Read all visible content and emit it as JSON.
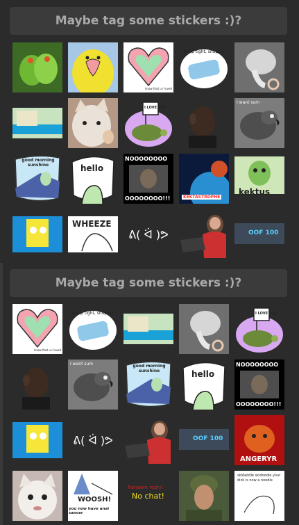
{
  "panels": [
    {
      "header": "Maybe tag some stickers :)?"
    },
    {
      "header": "Maybe tag some stickers :)?"
    }
  ],
  "stickers": {
    "sleep": "sleep tight, snupper",
    "know": "know that u r loved",
    "iloveyou": "I LOVE YOU",
    "iwantsum": "I want sum",
    "goodmorning": "good morning sunshine",
    "hello": "hello",
    "noooo_top": "NOOOOOOOO",
    "noooo_bot": "OOOOOOOO!!!",
    "kektastrophe": "KEKTASTROPHE",
    "kektus": "kektus",
    "wheeze": "WHEEZE",
    "shrug": "ᕕ( ᐛ )ᕗ",
    "oof": "OOF 100",
    "angeryr": "ANGERYR",
    "woosh_top": "WOOSH!",
    "woosh_bot": "you now have anal cancer",
    "nochat_top": "Random reply:",
    "nochat_bot": "No chat!",
    "skidaddle": "skidaddle skidoodle your dick is now a noodle"
  }
}
